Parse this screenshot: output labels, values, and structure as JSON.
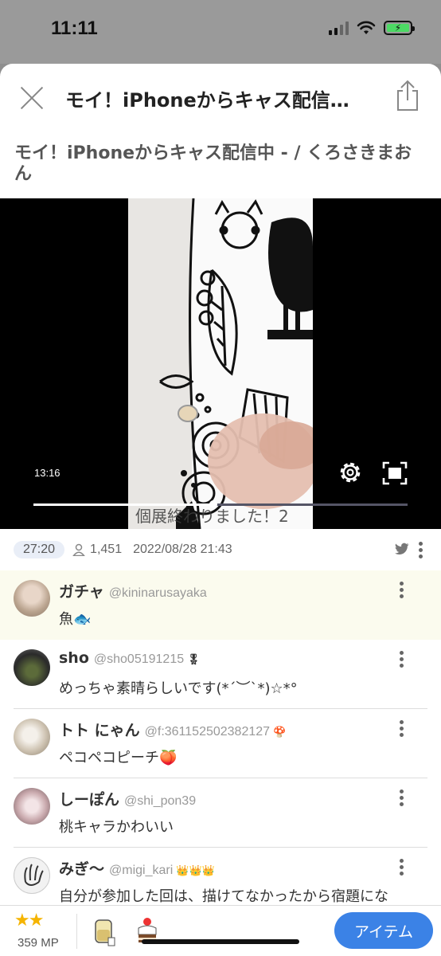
{
  "status_bar": {
    "time": "11:11"
  },
  "header": {
    "title": "モイ！iPhoneからキャス配信…",
    "close_icon": "close-icon",
    "share_icon": "share-icon"
  },
  "page_title": "モイ！iPhoneからキャス配信中 - / くろさきまおん",
  "video": {
    "current_time": "13:16",
    "progress": 0.48,
    "overlay_text": "個展終わりました！2",
    "controls": [
      "gear-icon",
      "fullscreen-icon"
    ]
  },
  "meta": {
    "duration": "27:20",
    "viewers": "1,451",
    "datetime": "2022/08/28 21:43"
  },
  "comments": [
    {
      "name": "ガチャ",
      "handle": "@kininarusayaka",
      "badge": "",
      "text": "魚🐟",
      "highlight": true
    },
    {
      "name": "sho",
      "handle": "@sho05191215",
      "badge": "🎖",
      "text": "めっちゃ素晴らしいです(*´︶`*)☆*°",
      "highlight": false
    },
    {
      "name": "トト にゃん",
      "handle": "@f:361152502382127",
      "badge": "🍄",
      "text": "ペコペコピーチ🍑",
      "highlight": false
    },
    {
      "name": "しーぽん",
      "handle": "@shi_pon39",
      "badge": "",
      "text": "桃キャラかわいい",
      "highlight": false
    },
    {
      "name": "みぎ〜",
      "handle": "@migi_kari",
      "badge": "👑👑👑",
      "text": "自分が参加した回は、描けてなかったから宿題にな",
      "highlight": false
    }
  ],
  "bottom_bar": {
    "stars": "★★",
    "points": "359 MP",
    "item_button": "アイテム"
  },
  "colors": {
    "accent": "#3b82e6",
    "highlight_row": "#fbfbee",
    "star": "#f5b400"
  }
}
